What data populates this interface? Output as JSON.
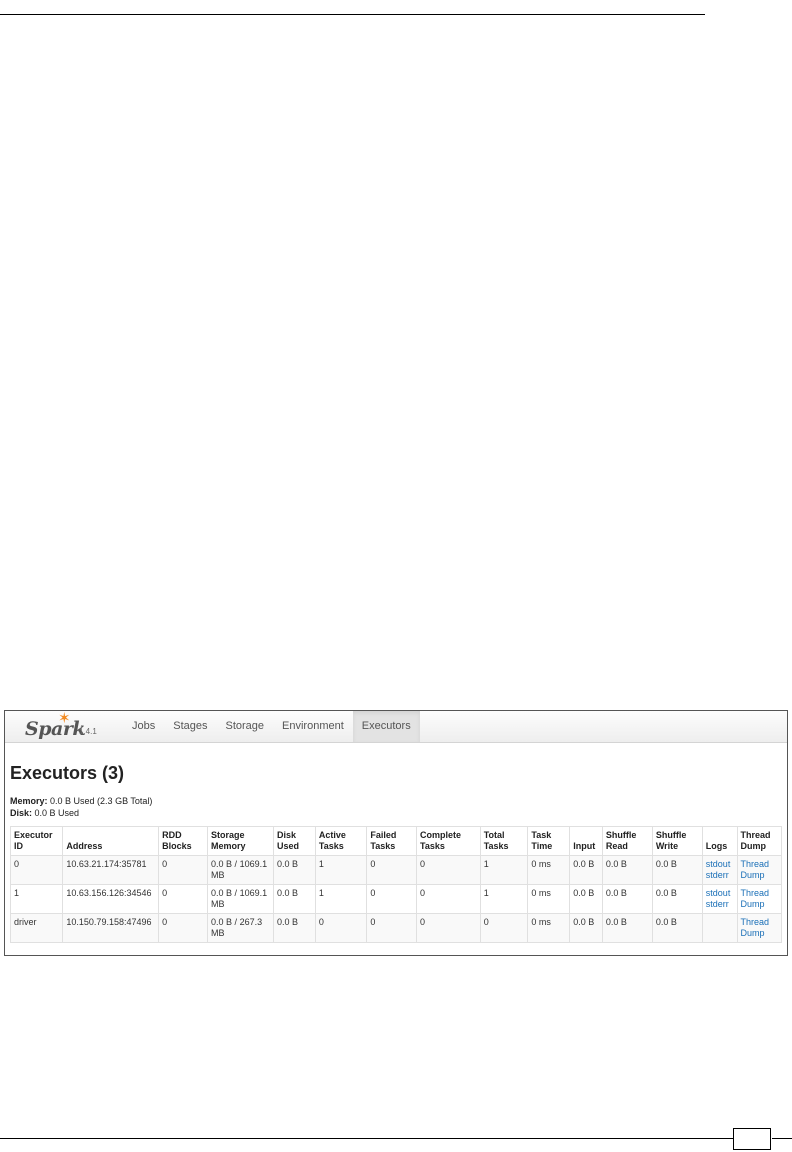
{
  "app": {
    "brand": "Spark",
    "version": "1.4.1",
    "nav_tabs": [
      {
        "label": "Jobs",
        "active": false
      },
      {
        "label": "Stages",
        "active": false
      },
      {
        "label": "Storage",
        "active": false
      },
      {
        "label": "Environment",
        "active": false
      },
      {
        "label": "Executors",
        "active": true
      }
    ]
  },
  "page": {
    "title": "Executors (3)",
    "memory_label": "Memory:",
    "memory_value": "0.0 B Used (2.3 GB Total)",
    "disk_label": "Disk:",
    "disk_value": "0.0 B Used"
  },
  "table": {
    "headers": [
      [
        "Executor",
        "ID"
      ],
      [
        "",
        "Address"
      ],
      [
        "RDD",
        "Blocks"
      ],
      [
        "Storage",
        "Memory"
      ],
      [
        "Disk",
        "Used"
      ],
      [
        "Active",
        "Tasks"
      ],
      [
        "Failed",
        "Tasks"
      ],
      [
        "Complete",
        "Tasks"
      ],
      [
        "Total",
        "Tasks"
      ],
      [
        "Task",
        "Time"
      ],
      [
        "",
        "Input"
      ],
      [
        "Shuffle",
        "Read"
      ],
      [
        "Shuffle",
        "Write"
      ],
      [
        "",
        "Logs"
      ],
      [
        "Thread",
        "Dump"
      ]
    ],
    "rows": [
      {
        "id": "0",
        "address": "10.63.21.174:35781",
        "rdd_blocks": "0",
        "storage_memory": [
          "0.0 B / 1069.1",
          "MB"
        ],
        "disk_used": "0.0 B",
        "active": "1",
        "failed": "0",
        "complete": "0",
        "total": "1",
        "task_time": "0 ms",
        "input": "0.0 B",
        "shuffle_read": "0.0 B",
        "shuffle_write": "0.0 B",
        "logs": [
          "stdout",
          "stderr"
        ],
        "thread_dump": [
          "Thread",
          "Dump"
        ]
      },
      {
        "id": "1",
        "address": "10.63.156.126:34546",
        "rdd_blocks": "0",
        "storage_memory": [
          "0.0 B / 1069.1",
          "MB"
        ],
        "disk_used": "0.0 B",
        "active": "1",
        "failed": "0",
        "complete": "0",
        "total": "1",
        "task_time": "0 ms",
        "input": "0.0 B",
        "shuffle_read": "0.0 B",
        "shuffle_write": "0.0 B",
        "logs": [
          "stdout",
          "stderr"
        ],
        "thread_dump": [
          "Thread",
          "Dump"
        ]
      },
      {
        "id": "driver",
        "address": "10.150.79.158:47496",
        "rdd_blocks": "0",
        "storage_memory": [
          "0.0 B / 267.3",
          "MB"
        ],
        "disk_used": "0.0 B",
        "active": "0",
        "failed": "0",
        "complete": "0",
        "total": "0",
        "task_time": "0 ms",
        "input": "0.0 B",
        "shuffle_read": "0.0 B",
        "shuffle_write": "0.0 B",
        "logs": [
          "",
          ""
        ],
        "thread_dump": [
          "Thread",
          "Dump"
        ]
      }
    ]
  },
  "colors": {
    "link": "#1a6fb7",
    "star": "#f28a20",
    "active_tab": "#e3e3e3"
  }
}
